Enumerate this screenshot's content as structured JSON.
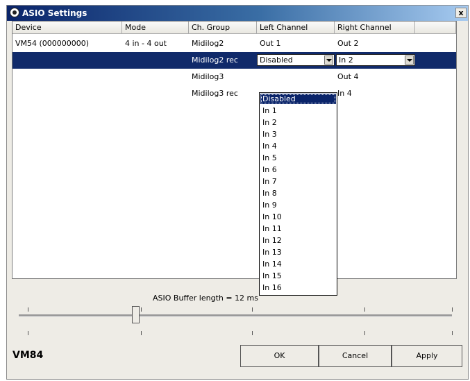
{
  "window": {
    "title": "ASIO Settings",
    "close_glyph": "x"
  },
  "columns": [
    "Device",
    "Mode",
    "Ch. Group",
    "Left Channel",
    "Right Channel"
  ],
  "rows": [
    {
      "device": "VM54 (000000000)",
      "mode": "4 in - 4 out",
      "group": "Midilog2",
      "left": "Out 1",
      "right": "Out 2"
    },
    {
      "group": "Midilog2 rec",
      "left": "Disabled",
      "right": "In 2"
    },
    {
      "group": "Midilog3",
      "left": "",
      "right": "Out 4"
    },
    {
      "group": "Midilog3 rec",
      "left": "",
      "right": "In 4"
    }
  ],
  "dropdown": {
    "items": [
      "Disabled",
      "In 1",
      "In 2",
      "In 3",
      "In 4",
      "In 5",
      "In 6",
      "In 7",
      "In 8",
      "In 9",
      "In 10",
      "In 11",
      "In 12",
      "In 13",
      "In 14",
      "In 15",
      "In 16"
    ],
    "highlighted": "Disabled"
  },
  "buffer": {
    "label": "ASIO Buffer length = 12 ms"
  },
  "footer": {
    "brand": "VM84",
    "ok": "OK",
    "cancel": "Cancel",
    "apply": "Apply"
  },
  "colors": {
    "selection": "#102a6a",
    "title_start": "#0a246a",
    "title_end": "#a6caf0"
  }
}
